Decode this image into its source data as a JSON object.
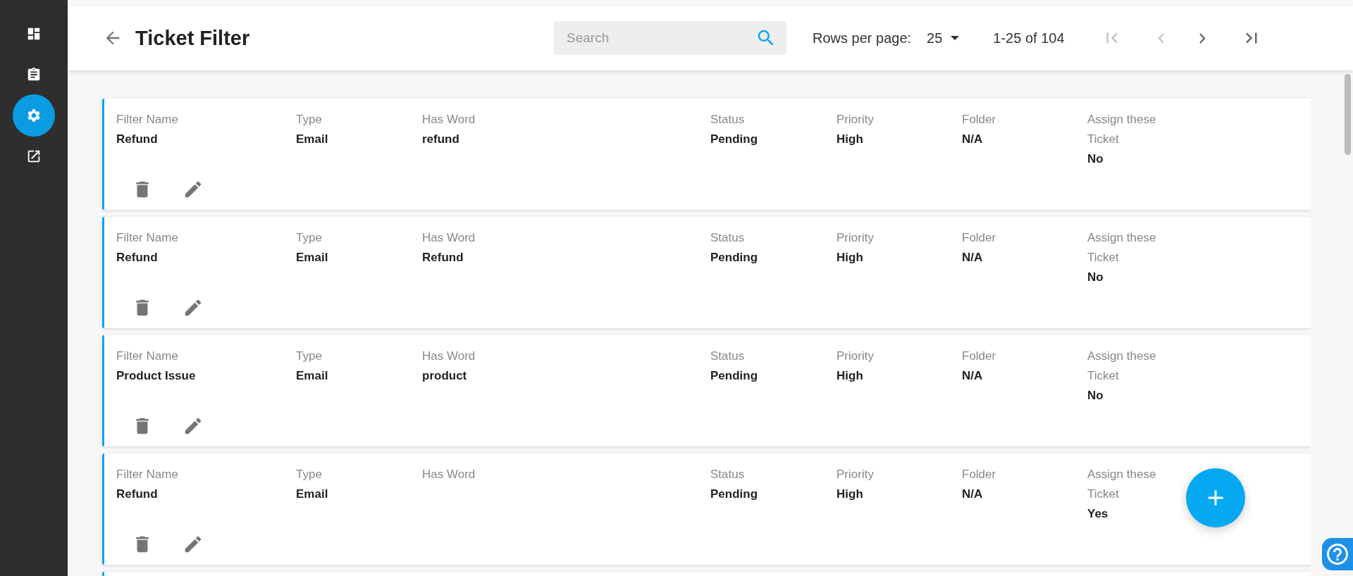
{
  "sidebar": {
    "items": [
      {
        "selected": false
      },
      {
        "selected": false
      },
      {
        "selected": true
      },
      {
        "selected": false
      }
    ]
  },
  "header": {
    "title": "Ticket Filter",
    "search": {
      "placeholder": "Search"
    },
    "rows_per_page": {
      "label": "Rows per page:",
      "value": "25"
    },
    "range": "1-25 of 104",
    "pager": [
      {
        "disabled": true
      },
      {
        "disabled": true
      },
      {
        "disabled": false
      },
      {
        "disabled": false
      }
    ]
  },
  "filters": [
    {
      "fields": [
        {
          "label": "Filter Name",
          "value": "Refund"
        },
        {
          "label": "Type",
          "value": "Email"
        },
        {
          "label": "Has Word",
          "value": "refund"
        },
        {
          "label": "Status",
          "value": "Pending"
        },
        {
          "label": "Priority",
          "value": "High"
        },
        {
          "label": "Folder",
          "value": "N/A"
        },
        {
          "label": "Assign these Ticket",
          "value": "No"
        }
      ]
    },
    {
      "fields": [
        {
          "label": "Filter Name",
          "value": "Refund"
        },
        {
          "label": "Type",
          "value": "Email"
        },
        {
          "label": "Has Word",
          "value": "Refund"
        },
        {
          "label": "Status",
          "value": "Pending"
        },
        {
          "label": "Priority",
          "value": "High"
        },
        {
          "label": "Folder",
          "value": "N/A"
        },
        {
          "label": "Assign these Ticket",
          "value": "No"
        }
      ]
    },
    {
      "fields": [
        {
          "label": "Filter Name",
          "value": "Product Issue"
        },
        {
          "label": "Type",
          "value": "Email"
        },
        {
          "label": "Has Word",
          "value": "product"
        },
        {
          "label": "Status",
          "value": "Pending"
        },
        {
          "label": "Priority",
          "value": "High"
        },
        {
          "label": "Folder",
          "value": "N/A"
        },
        {
          "label": "Assign these Ticket",
          "value": "No"
        }
      ]
    },
    {
      "fields": [
        {
          "label": "Filter Name",
          "value": "Refund"
        },
        {
          "label": "Type",
          "value": "Email"
        },
        {
          "label": "Has Word"
        },
        {
          "label": "Status",
          "value": "Pending"
        },
        {
          "label": "Priority",
          "value": "High"
        },
        {
          "label": "Folder",
          "value": "N/A"
        },
        {
          "label": "Assign these Ticket",
          "value": "Yes"
        }
      ]
    }
  ]
}
